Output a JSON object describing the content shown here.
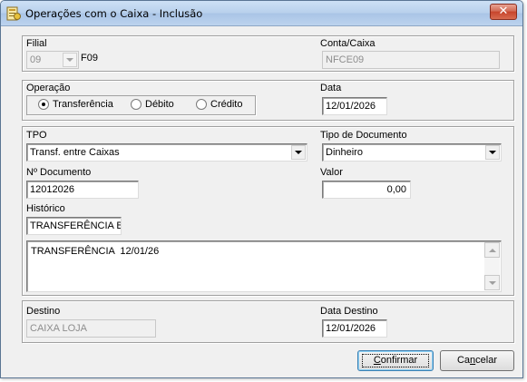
{
  "window": {
    "title": "Operações com o Caixa - Inclusão",
    "close_glyph": "✕"
  },
  "filial": {
    "label": "Filial",
    "value": "09",
    "code": "F09"
  },
  "conta_caixa": {
    "label": "Conta/Caixa",
    "value": "NFCE09"
  },
  "operacao": {
    "label": "Operação",
    "options": [
      {
        "label": "Transferência",
        "checked": true
      },
      {
        "label": "Débito",
        "checked": false
      },
      {
        "label": "Crédito",
        "checked": false
      }
    ]
  },
  "data": {
    "label": "Data",
    "value": "12/01/2026"
  },
  "tpo": {
    "label": "TPO",
    "value": "Transf. entre Caixas"
  },
  "tipo_documento": {
    "label": "Tipo de Documento",
    "value": "Dinheiro"
  },
  "num_documento": {
    "label": "Nº Documento",
    "value": "12012026"
  },
  "valor": {
    "label": "Valor",
    "value": "0,00"
  },
  "historico": {
    "label": "Histórico",
    "short_value": "TRANSFERÊNCIA BA",
    "text": "TRANSFERÊNCIA  12/01/26"
  },
  "destino": {
    "label": "Destino",
    "value": "CAIXA LOJA"
  },
  "data_destino": {
    "label": "Data Destino",
    "value": "12/01/2026"
  },
  "buttons": {
    "confirm_pre": "",
    "confirm_u": "C",
    "confirm_post": "onfirmar",
    "cancel_pre": "Ca",
    "cancel_u": "n",
    "cancel_post": "celar"
  },
  "icons": {
    "title_icon": "money-icon",
    "close_icon": "close-icon"
  }
}
